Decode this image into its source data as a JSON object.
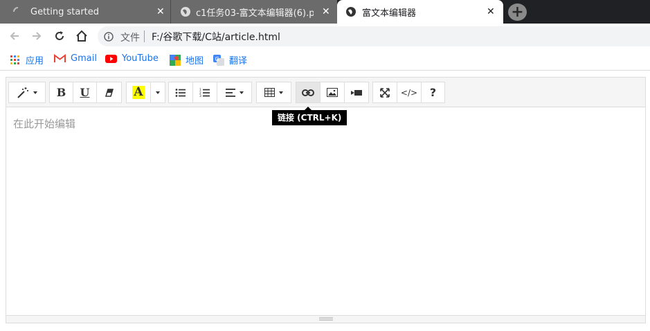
{
  "browser": {
    "tabs": [
      {
        "title": "Getting started",
        "icon": "loading-spinner-icon"
      },
      {
        "title": "c1任务03-富文本编辑器(6).pdf",
        "icon": "globe-icon"
      },
      {
        "title": "富文本编辑器",
        "icon": "globe-icon",
        "active": true
      }
    ],
    "address": {
      "scheme": "文件",
      "url": "F:/谷歌下载/C站/article.html"
    },
    "bookmarks": [
      {
        "label": "应用",
        "icon": "apps-grid-icon"
      },
      {
        "label": "Gmail",
        "icon": "gmail-icon"
      },
      {
        "label": "YouTube",
        "icon": "youtube-icon"
      },
      {
        "label": "地图",
        "icon": "maps-icon"
      },
      {
        "label": "翻译",
        "icon": "translate-icon"
      }
    ]
  },
  "editor": {
    "placeholder": "在此开始编辑",
    "tooltip": "链接 (CTRL+K)",
    "toolbar": {
      "bold": "B",
      "underline": "U",
      "color_letter": "A",
      "help": "?",
      "code": "</>"
    }
  },
  "colors": {
    "tab_strip": "#202124",
    "link_blue": "#1a73e8",
    "highlight_yellow": "#ffff00"
  }
}
